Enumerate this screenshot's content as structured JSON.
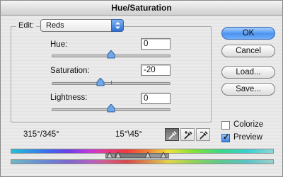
{
  "window": {
    "title": "Hue/Saturation"
  },
  "edit": {
    "label": "Edit:",
    "selected": "Reds"
  },
  "sliders": [
    {
      "label": "Hue:",
      "value": "0",
      "level": 0
    },
    {
      "label": "Saturation:",
      "value": "-20",
      "level": -20
    },
    {
      "label": "Lightness:",
      "value": "0",
      "level": 0
    }
  ],
  "buttons": {
    "ok": "OK",
    "cancel": "Cancel",
    "load": "Load...",
    "save": "Save..."
  },
  "options": {
    "colorize": {
      "label": "Colorize",
      "checked": false
    },
    "preview": {
      "label": "Preview",
      "checked": true
    }
  },
  "readouts": {
    "left": "315°/345°",
    "right": "15°\\45°"
  },
  "eyedroppers": [
    "eyedropper-icon",
    "eyedropper-plus-icon",
    "eyedropper-minus-icon"
  ],
  "colors": {
    "accent": "#4b93f0"
  }
}
